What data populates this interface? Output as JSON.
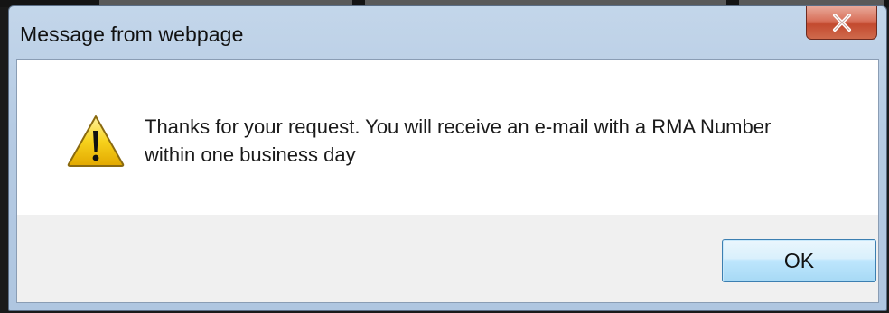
{
  "dialog": {
    "title": "Message from webpage",
    "close_label": "close",
    "message_line1": "Thanks for your request. You will receive an e-mail with a RMA Number",
    "message_line2": "within one business day",
    "icon": "warning-icon",
    "ok_label": "OK"
  },
  "colors": {
    "titlebar": "#b6cbe3",
    "close_button": "#c34a2f",
    "ok_button_border": "#3c7fb1",
    "warning_yellow": "#f5c400"
  }
}
